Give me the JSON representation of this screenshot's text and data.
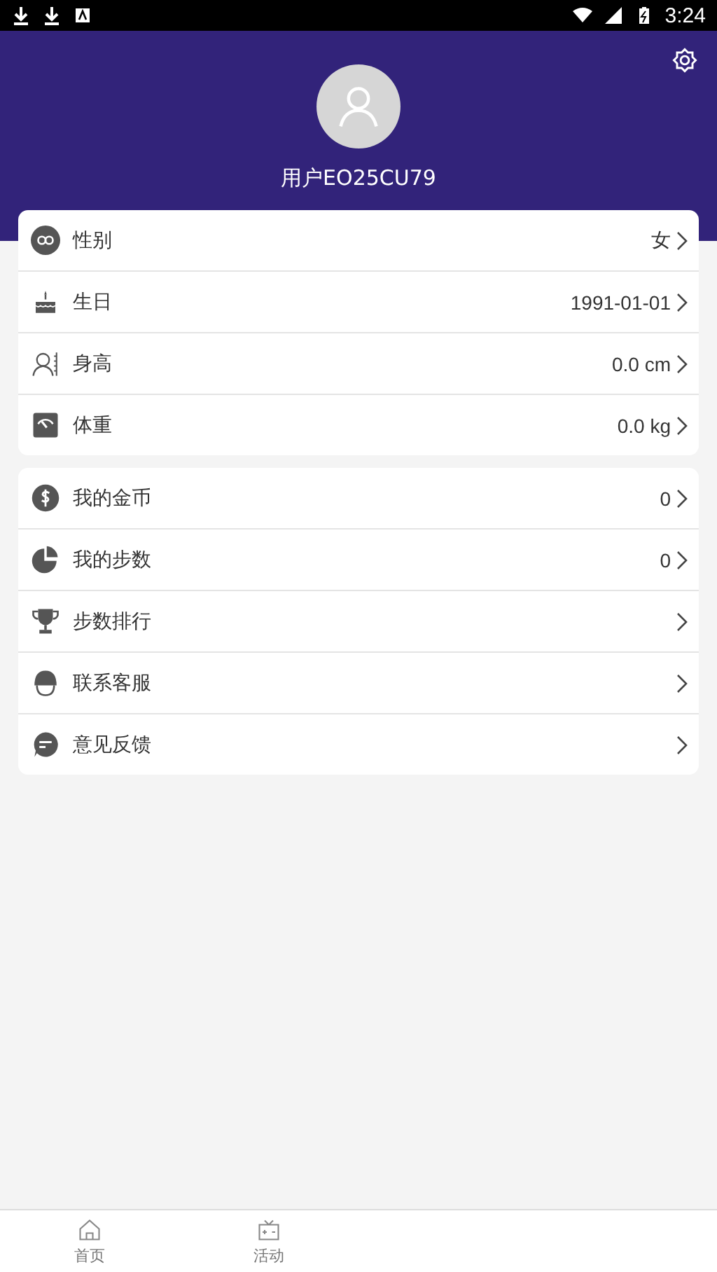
{
  "status_bar": {
    "time": "3:24"
  },
  "profile": {
    "username": "用户EO25CU79"
  },
  "groups": [
    {
      "items": [
        {
          "label": "性别",
          "value": "女"
        },
        {
          "label": "生日",
          "value": "1991-01-01"
        },
        {
          "label": "身高",
          "value": "0.0 cm"
        },
        {
          "label": "体重",
          "value": "0.0 kg"
        }
      ]
    },
    {
      "items": [
        {
          "label": "我的金币",
          "value": "0"
        },
        {
          "label": "我的步数",
          "value": "0"
        },
        {
          "label": "步数排行"
        },
        {
          "label": "联系客服"
        },
        {
          "label": "意见反馈"
        }
      ]
    }
  ],
  "bottom_nav": [
    {
      "label": "首页"
    },
    {
      "label": "活动"
    }
  ]
}
